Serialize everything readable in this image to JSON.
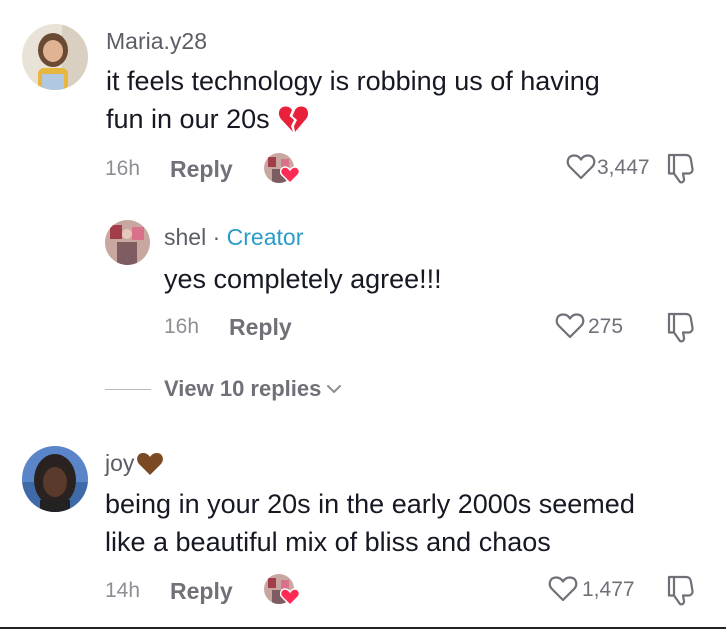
{
  "comments": [
    {
      "username": "Maria.y28",
      "text_line1": "it feels technology is robbing us of having",
      "text_line2": "fun in our 20s",
      "emoji": "broken-heart-icon",
      "time": "16h",
      "reply_label": "Reply",
      "likes": "3,447"
    },
    {
      "username": "joy",
      "username_emoji": "brown-heart-icon",
      "text_line1": "being in your 20s in the early 2000s seemed",
      "text_line2": "like a beautiful mix of bliss and chaos",
      "time": "14h",
      "reply_label": "Reply",
      "likes": "1,477"
    }
  ],
  "reply": {
    "username": "shel",
    "separator": "·",
    "badge": "Creator",
    "text": "yes completely agree!!!",
    "time": "16h",
    "reply_label": "Reply",
    "likes": "275"
  },
  "view_replies": {
    "label": "View 10 replies"
  },
  "colors": {
    "creator_badge": "#2a9cc8",
    "broken_heart": "#e8203a",
    "brown_heart": "#7a4a24",
    "text_primary": "#161823",
    "text_secondary": "#6f7078"
  }
}
